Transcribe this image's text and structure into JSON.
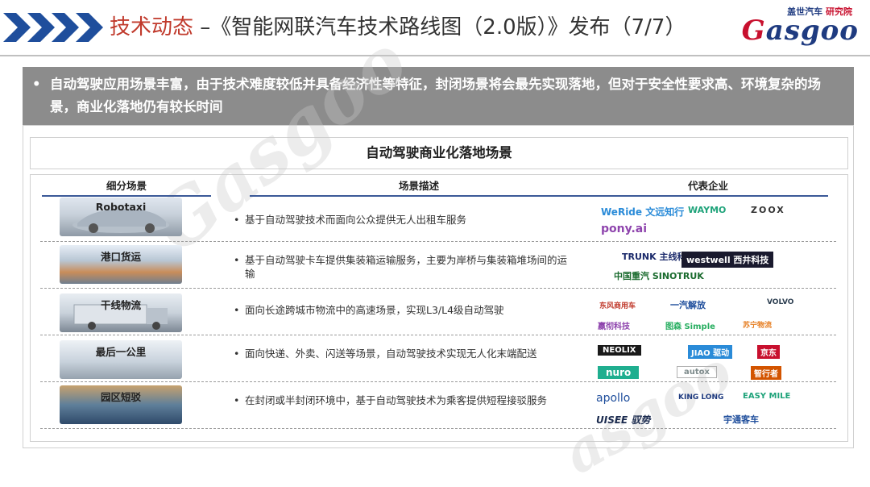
{
  "header": {
    "title_prefix": "技术动态",
    "title_rest": " –《智能网联汽车技术路线图（2.0版）》发布（7/7）",
    "logo_cn_left": "盖世汽车",
    "logo_cn_right": "研究院",
    "logo_text": "asgoo",
    "logo_g": "G"
  },
  "banner": {
    "bullet": "•",
    "text": "自动驾驶应用场景丰富，由于技术难度较低并具备经济性等特征，封闭场景将会最先实现落地，但对于安全性要求高、环境复杂的场景，商业化落地仍有较长时间"
  },
  "section_title": "自动驾驶商业化落地场景",
  "columns": {
    "scene": "细分场景",
    "description": "场景描述",
    "companies": "代表企业"
  },
  "rows": [
    {
      "scene": "Robotaxi",
      "bullet": "•",
      "description": "基于自动驾驶技术而面向公众提供无人出租车服务",
      "companies": [
        "WeRide 文远知行",
        "WAYMO",
        "ZOOX",
        "pony.ai"
      ]
    },
    {
      "scene": "港口货运",
      "bullet": "•",
      "description": "基于自动驾驶卡车提供集装箱运输服务，主要为岸桥与集装箱堆场间的运输",
      "companies": [
        "TRUNK 主线科技",
        "westwell 西井科技",
        "中国重汽 SINOTRUK"
      ]
    },
    {
      "scene": "干线物流",
      "bullet": "•",
      "description": "面向长途跨城市物流中的高速场景，实现L3/L4级自动驾驶",
      "companies": [
        "东风商用车",
        "一汽解放",
        "VOLVO",
        "嬴彻科技",
        "图森 Simple",
        "苏宁物流"
      ]
    },
    {
      "scene": "最后一公里",
      "bullet": "•",
      "description": "面向快递、外卖、闪送等场景，自动驾驶技术实现无人化末端配送",
      "companies": [
        "NEOLIX",
        "JIAO 驱动",
        "京东",
        "nuro",
        "autox",
        "智行者"
      ]
    },
    {
      "scene": "园区短驳",
      "bullet": "•",
      "description": "在封闭或半封闭环境中，基于自动驾驶技术为乘客提供短程接驳服务",
      "companies": [
        "apollo",
        "KING LONG",
        "EASY MILE",
        "UISEE 驭势",
        "宇通客车"
      ]
    }
  ],
  "colors": {
    "accent_red": "#c0392b",
    "chevron_blue": "#1f4e9c",
    "banner_gray": "#8c8c8c",
    "rule_blue": "#3b5998"
  }
}
